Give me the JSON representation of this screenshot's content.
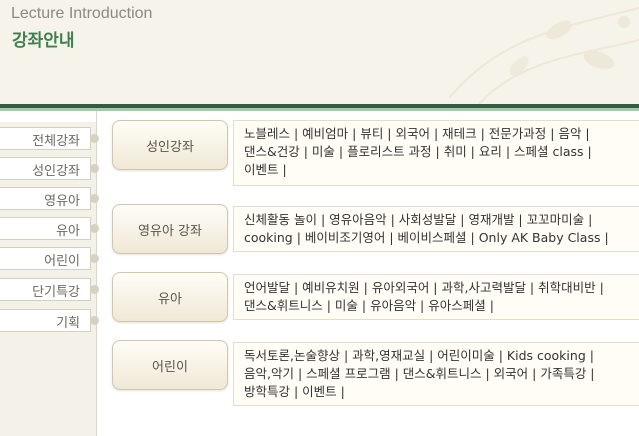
{
  "header": {
    "title_en": "Lecture Introduction",
    "title_ko": "강좌안내"
  },
  "sidebar": {
    "items": [
      {
        "label": "전체강좌"
      },
      {
        "label": "성인강좌"
      },
      {
        "label": "영유아"
      },
      {
        "label": "유아"
      },
      {
        "label": "어린이"
      },
      {
        "label": "단기특강"
      },
      {
        "label": "기획"
      }
    ]
  },
  "categories": [
    {
      "label": "성인강좌",
      "courses": "노블레스 | 예비엄마 | 뷰티 | 외국어 | 재테크 | 전문가과정 | 음악 |\n댄스&건강 | 미술 | 플로리스트 과정 | 취미 | 요리 | 스페셜 class |\n이벤트 |"
    },
    {
      "label": "영유아 강좌",
      "courses": "신체활동 놀이 | 영유아음악 | 사회성발달 | 영재개발 | 꼬꼬마미술 |\ncooking | 베이비조기영어 | 베이비스페셜 | Only AK Baby Class |"
    },
    {
      "label": "유아",
      "courses": "언어발달 | 예비유치원 | 유아외국어 | 과학,사고력발달 | 취학대비반 |\n댄스&휘트니스 | 미술 | 유아음악 | 유아스페셜 |"
    },
    {
      "label": "어린이",
      "courses": "독서토론,논술향상 | 과학,영재교실 | 어린이미술 | Kids cooking |\n음악,악기 | 스페셜 프로그램 | 댄스&휘트니스 | 외국어 | 가족특강 |\n방학특강 | 이벤트 |"
    }
  ],
  "colors": {
    "accent_green": "#3f8050",
    "rule_dark": "#2f5e42",
    "header_bg": "#f6f3ea"
  }
}
